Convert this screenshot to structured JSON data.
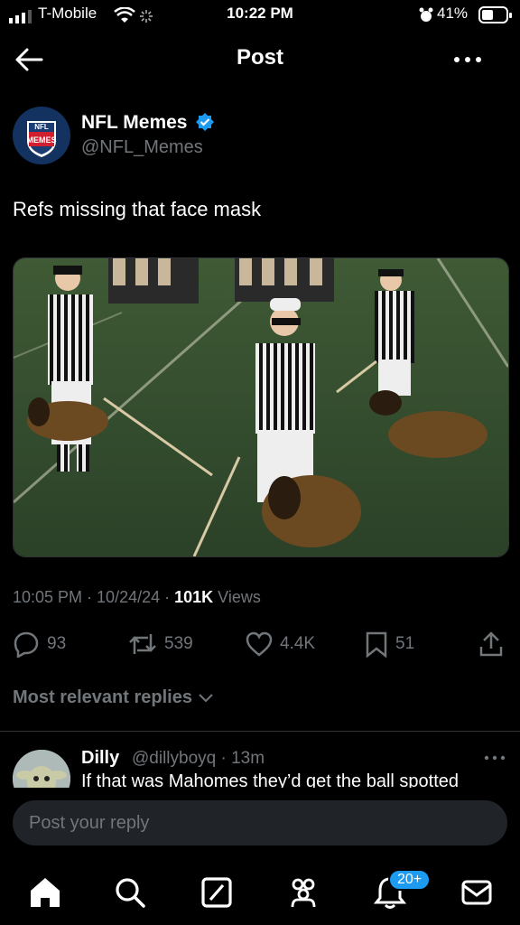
{
  "status": {
    "carrier": "T-Mobile",
    "time": "10:22 PM",
    "battery": "41%"
  },
  "header": {
    "title": "Post"
  },
  "post": {
    "author_name": "NFL Memes",
    "author_handle": "@NFL_Memes",
    "text": "Refs missing that face mask",
    "meta_time": "10:05 PM · 10/24/24 · ",
    "views_count": "101K",
    "views_label": " Views",
    "replies": "93",
    "reposts": "539",
    "likes": "4.4K",
    "bookmarks": "51"
  },
  "replies_filter": "Most relevant replies",
  "reply": {
    "name": "Dilly",
    "handle": "@dillyboyq · 13m",
    "text": "If that was Mahomes they’d get the ball spotted"
  },
  "composer": {
    "placeholder": "Post your reply"
  },
  "tabbar": {
    "notification_badge": "20+"
  },
  "colors": {
    "accent": "#1d9bf0",
    "muted": "#71767b",
    "background": "#000000"
  }
}
